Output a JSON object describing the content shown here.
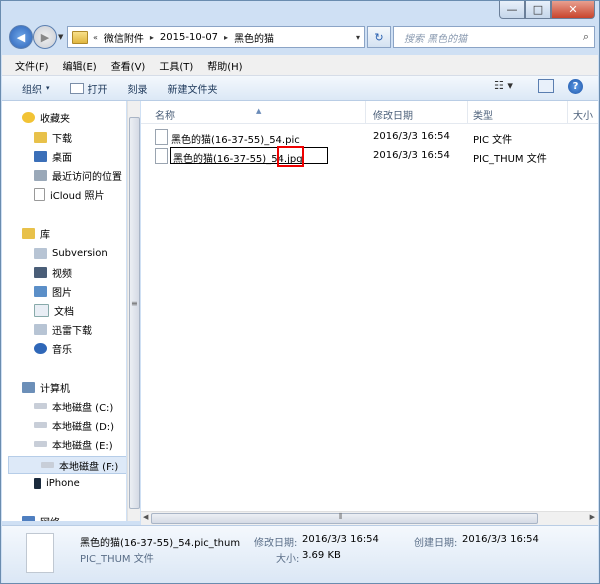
{
  "window": {
    "min": "—",
    "max": "□",
    "close": "✕"
  },
  "address": {
    "history": "«",
    "segments": [
      "微信附件",
      "2015-10-07",
      "黑色的猫"
    ],
    "separators": [
      "▸",
      "▸",
      "▸"
    ],
    "dropdown": "▾",
    "refresh": "↻"
  },
  "search": {
    "placeholder": "搜索 黑色的猫",
    "icon": "⌕"
  },
  "menubar": [
    "文件(F)",
    "编辑(E)",
    "查看(V)",
    "工具(T)",
    "帮助(H)"
  ],
  "toolbar": {
    "organize": "组织",
    "organize_arrow": "▾",
    "open": "打开",
    "burn": "刻录",
    "new_folder": "新建文件夹",
    "view_icon": "☷ ▾",
    "help": "?"
  },
  "nav": {
    "favorites": {
      "label": "收藏夹",
      "items": [
        "下载",
        "桌面",
        "最近访问的位置",
        "iCloud 照片"
      ]
    },
    "libraries": {
      "label": "库",
      "items": [
        "Subversion",
        "视频",
        "图片",
        "文档",
        "迅雷下载",
        "音乐"
      ]
    },
    "computer": {
      "label": "计算机",
      "items": [
        "本地磁盘 (C:)",
        "本地磁盘 (D:)",
        "本地磁盘 (E:)",
        "本地磁盘 (F:)",
        "iPhone"
      ]
    },
    "network": {
      "label": "网络"
    }
  },
  "columns": {
    "name": "名称",
    "modified": "修改日期",
    "type": "类型",
    "size": "大小"
  },
  "files": [
    {
      "name": "黑色的猫(16-37-55)_54.pic",
      "modified": "2016/3/3 16:54",
      "type": "PIC 文件"
    },
    {
      "name": "黑色的猫(16-37-55)_54.jpg",
      "modified": "2016/3/3 16:54",
      "type": "PIC_THUM 文件"
    }
  ],
  "details": {
    "filename": "黑色的猫(16-37-55)_54.pic_thum",
    "filetype": "PIC_THUM 文件",
    "modified_label": "修改日期:",
    "modified_value": "2016/3/3 16:54",
    "size_label": "大小:",
    "size_value": "3.69 KB",
    "created_label": "创建日期:",
    "created_value": "2016/3/3 16:54"
  },
  "colors": {
    "accent": "#1e395b",
    "highlight": "#e00000",
    "selection": "#dde9f8"
  }
}
